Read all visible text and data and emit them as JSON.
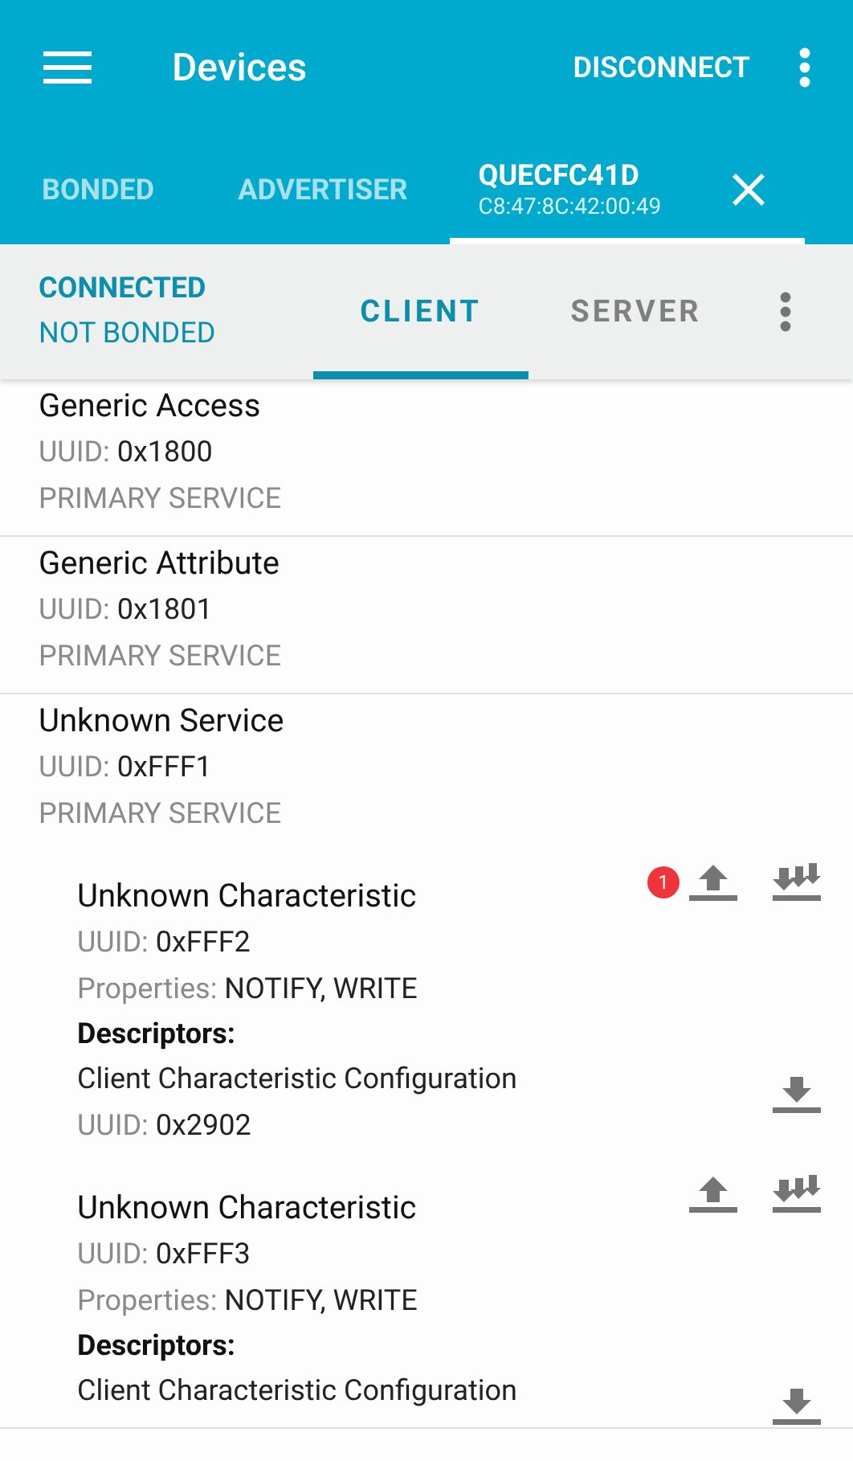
{
  "app_bar": {
    "title": "Devices",
    "action": "DISCONNECT"
  },
  "tabs": [
    {
      "kind": "plain",
      "label": "BONDED",
      "selected": false
    },
    {
      "kind": "plain",
      "label": "ADVERTISER",
      "selected": false
    },
    {
      "kind": "device",
      "label": "QUECFC41D",
      "address": "C8:47:8C:42:00:49",
      "selected": true
    }
  ],
  "connection": {
    "state": "CONNECTED",
    "bond": "NOT BONDED"
  },
  "sub_tabs": [
    {
      "label": "CLIENT",
      "selected": true
    },
    {
      "label": "SERVER",
      "selected": false
    }
  ],
  "services": [
    {
      "name": "Generic Access",
      "uuid_label": "UUID:",
      "uuid": "0x1800",
      "type": "PRIMARY SERVICE"
    },
    {
      "name": "Generic Attribute",
      "uuid_label": "UUID:",
      "uuid": "0x1801",
      "type": "PRIMARY SERVICE"
    },
    {
      "name": "Unknown Service",
      "uuid_label": "UUID:",
      "uuid": "0xFFF1",
      "type": "PRIMARY SERVICE",
      "characteristics": [
        {
          "name": "Unknown Characteristic",
          "uuid_label": "UUID:",
          "uuid": "0xFFF2",
          "properties_label": "Properties:",
          "properties": "NOTIFY, WRITE",
          "badge": "1",
          "descriptors_label": "Descriptors:",
          "descriptors": [
            {
              "name": "Client Characteristic Configuration",
              "uuid_label": "UUID:",
              "uuid": "0x2902"
            }
          ]
        },
        {
          "name": "Unknown Characteristic",
          "uuid_label": "UUID:",
          "uuid": "0xFFF3",
          "properties_label": "Properties:",
          "properties": "NOTIFY, WRITE",
          "descriptors_label": "Descriptors:",
          "descriptors": [
            {
              "name": "Client Characteristic Configuration"
            }
          ]
        }
      ]
    }
  ]
}
